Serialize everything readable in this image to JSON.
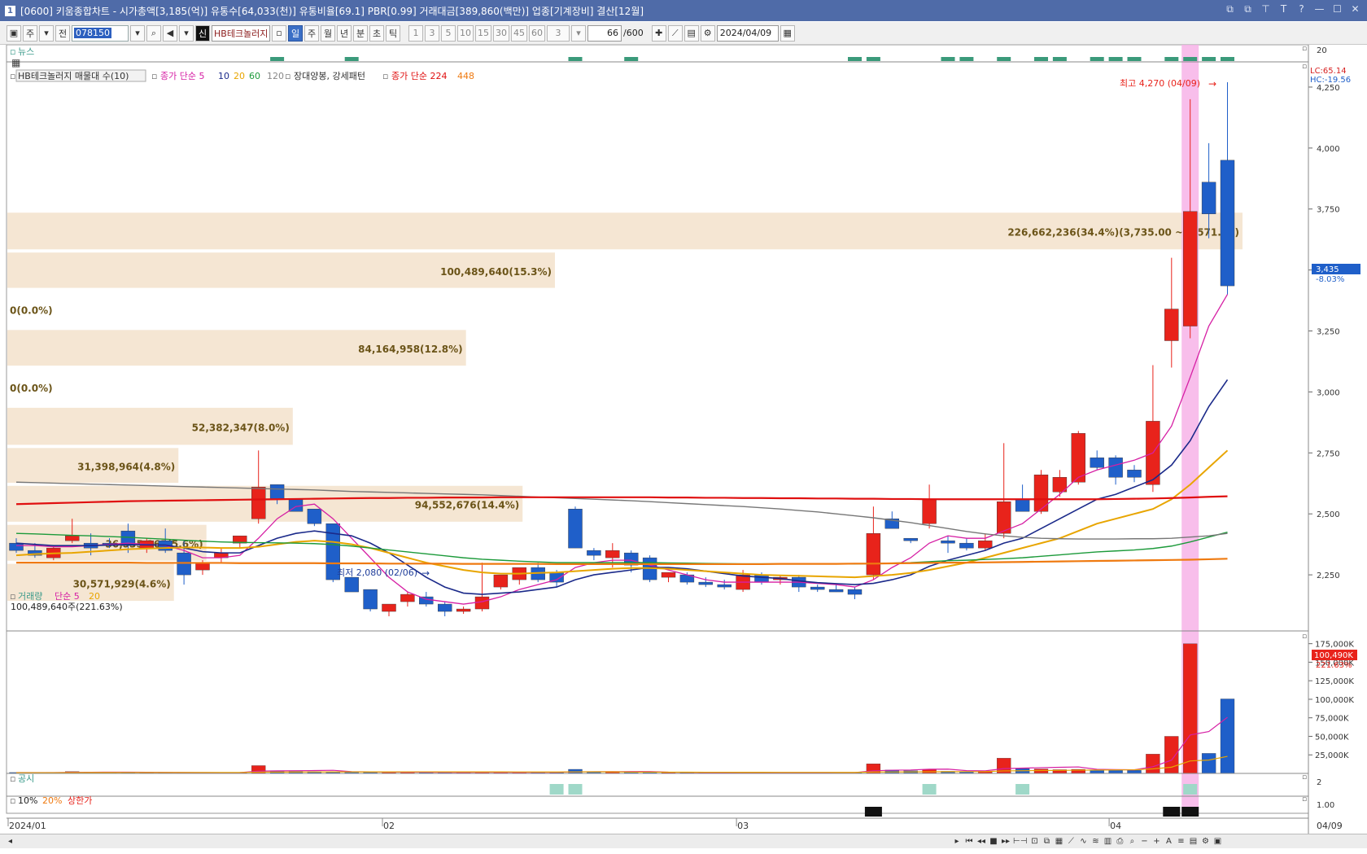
{
  "window": {
    "icon_label": "1",
    "title": "[0600] 키움종합차트 - 시가총액[3,185(억)] 유통수[64,033(천)] 유통비율[69.1] PBR[0.99] 거래대금[389,860(백만)] 업종[기계장비] 결산[12월]",
    "buttons": [
      "⧉",
      "⧉",
      "⊤",
      "T",
      "?",
      "—",
      "☐",
      "✕"
    ]
  },
  "toolbar": {
    "period_main": "주",
    "prev_label": "전",
    "stock_code": "078150",
    "stock_name": "HB테크놀러지",
    "timeframes": [
      "일",
      "주",
      "월",
      "년",
      "분",
      "초",
      "틱"
    ],
    "selected_timeframe": "일",
    "intervals": [
      "1",
      "3",
      "5",
      "10",
      "15",
      "30",
      "45",
      "60"
    ],
    "interval_select": "3",
    "count_value": "66",
    "count_total": "/600",
    "date": "2024/04/09"
  },
  "legends": {
    "news": "뉴스",
    "price_title": "HB테크놀러지 매물대 수(10)",
    "ma_label": "종가 단순 5",
    "ma_10": "10",
    "ma_20": "20",
    "ma_60": "60",
    "ma_120": "120",
    "pattern": "장대양봉, 강세패턴",
    "ma_long_label": "종가 단순 224",
    "ma_448": "448",
    "volume_title": "거래량",
    "volume_ma": "단순 5",
    "volume_ma20": "20",
    "volume_value": "100,489,640주(221.63%)",
    "disclosure": "공시",
    "limit_10": "10%",
    "limit_20": "20%",
    "limit_upper": "상한가"
  },
  "annotations": {
    "high_label": "최고 4,270 (04/09)",
    "low_label": "최저 2,080 (02/06)",
    "lc": "LC:65.14",
    "hc": "HC:-19.56",
    "current_price": "3,435",
    "current_change": "-8.03%",
    "volume_current": "100,490K",
    "volume_ratio": "221.63%"
  },
  "colors": {
    "up": "#e8231b",
    "down": "#1f5fc9",
    "ma5": "#d61fa4",
    "ma10": "#1b2a8a",
    "ma20": "#e8a500",
    "ma60": "#1c9a3a",
    "ma120": "#777777",
    "ma224": "#e01010",
    "ma448": "#ef7a10",
    "volume_profile": "#f5e6d3",
    "highlight": "#f7b3e8"
  },
  "chart_data": {
    "type": "candlestick",
    "y_ticks": [
      "4,250",
      "4,000",
      "3,750",
      "3,500",
      "3,250",
      "3,000",
      "2,750",
      "2,500",
      "2,250"
    ],
    "y_range": [
      2020,
      4350
    ],
    "news_axis_tick": "20",
    "volume_ticks": [
      "175,000K",
      "150,000K",
      "125,000K",
      "100,000K",
      "75,000K",
      "50,000K",
      "25,000K"
    ],
    "volume_range": [
      0,
      190000
    ],
    "disclosure_tick": "2",
    "limit_tick": "1.00",
    "x_labels": [
      {
        "label": "2024/01",
        "index": 0
      },
      {
        "label": "02",
        "index": 20
      },
      {
        "label": "03",
        "index": 39
      },
      {
        "label": "04",
        "index": 59
      }
    ],
    "last_date_label": "04/09",
    "volume_profile": [
      {
        "label": "226,662,236(34.4%)(3,735.00 ~ 3,571.50)",
        "value": 226662236,
        "low": 3571.5,
        "high": 3735
      },
      {
        "label": "100,489,640(15.3%)",
        "value": 100489640,
        "low": 3414,
        "high": 3571.5
      },
      {
        "label": "0(0.0%)",
        "value": 0,
        "low": 3254,
        "high": 3414
      },
      {
        "label": "84,164,958(12.8%)",
        "value": 84164958,
        "low": 3095,
        "high": 3254
      },
      {
        "label": "0(0.0%)",
        "value": 0,
        "low": 2935,
        "high": 3095
      },
      {
        "label": "52,382,347(8.0%)",
        "value": 52382347,
        "low": 2770,
        "high": 2935
      },
      {
        "label": "31,398,964(4.8%)",
        "value": 31398964,
        "low": 2615,
        "high": 2770
      },
      {
        "label": "94,552,676(14.4%)",
        "value": 94552676,
        "low": 2455,
        "high": 2615
      },
      {
        "label": "36,535,365(5.6%)",
        "value": 36535365,
        "low": 2295,
        "high": 2455
      },
      {
        "label": "30,571,929(4.6%)",
        "value": 30571929,
        "low": 2130,
        "high": 2295
      }
    ],
    "candles": [
      [
        2380,
        2400,
        2340,
        2350
      ],
      [
        2350,
        2380,
        2320,
        2330
      ],
      [
        2320,
        2370,
        2310,
        2360
      ],
      [
        2390,
        2480,
        2380,
        2410
      ],
      [
        2380,
        2420,
        2330,
        2360
      ],
      [
        2380,
        2400,
        2360,
        2370
      ],
      [
        2430,
        2460,
        2340,
        2370
      ],
      [
        2360,
        2400,
        2340,
        2390
      ],
      [
        2390,
        2440,
        2340,
        2350
      ],
      [
        2340,
        2390,
        2210,
        2250
      ],
      [
        2270,
        2310,
        2250,
        2300
      ],
      [
        2320,
        2360,
        2300,
        2340
      ],
      [
        2380,
        2410,
        2360,
        2410
      ],
      [
        2480,
        2760,
        2460,
        2610
      ],
      [
        2620,
        2620,
        2540,
        2560
      ],
      [
        2560,
        2560,
        2520,
        2510
      ],
      [
        2520,
        2520,
        2450,
        2460
      ],
      [
        2460,
        2460,
        2220,
        2230
      ],
      [
        2240,
        2240,
        2190,
        2180
      ],
      [
        2190,
        2190,
        2100,
        2110
      ],
      [
        2100,
        2120,
        2080,
        2130
      ],
      [
        2140,
        2180,
        2120,
        2170
      ],
      [
        2160,
        2180,
        2120,
        2130
      ],
      [
        2130,
        2140,
        2080,
        2100
      ],
      [
        2100,
        2120,
        2090,
        2110
      ],
      [
        2110,
        2300,
        2100,
        2160
      ],
      [
        2200,
        2240,
        2190,
        2250
      ],
      [
        2230,
        2270,
        2210,
        2280
      ],
      [
        2280,
        2300,
        2220,
        2230
      ],
      [
        2260,
        2270,
        2200,
        2220
      ],
      [
        2520,
        2530,
        2360,
        2360
      ],
      [
        2350,
        2360,
        2310,
        2330
      ],
      [
        2320,
        2380,
        2280,
        2350
      ],
      [
        2340,
        2350,
        2260,
        2290
      ],
      [
        2320,
        2330,
        2220,
        2230
      ],
      [
        2240,
        2260,
        2220,
        2260
      ],
      [
        2250,
        2260,
        2210,
        2220
      ],
      [
        2220,
        2240,
        2200,
        2210
      ],
      [
        2210,
        2230,
        2190,
        2200
      ],
      [
        2190,
        2270,
        2180,
        2250
      ],
      [
        2250,
        2260,
        2210,
        2220
      ],
      [
        2230,
        2250,
        2210,
        2240
      ],
      [
        2240,
        2250,
        2180,
        2200
      ],
      [
        2200,
        2210,
        2180,
        2190
      ],
      [
        2190,
        2210,
        2180,
        2180
      ],
      [
        2190,
        2200,
        2150,
        2170
      ],
      [
        2250,
        2530,
        2230,
        2420
      ],
      [
        2480,
        2510,
        2460,
        2440
      ],
      [
        2400,
        2400,
        2380,
        2390
      ],
      [
        2460,
        2620,
        2440,
        2560
      ],
      [
        2390,
        2410,
        2340,
        2380
      ],
      [
        2380,
        2400,
        2350,
        2360
      ],
      [
        2360,
        2420,
        2350,
        2390
      ],
      [
        2420,
        2790,
        2400,
        2550
      ],
      [
        2560,
        2620,
        2540,
        2510
      ],
      [
        2510,
        2680,
        2500,
        2660
      ],
      [
        2590,
        2680,
        2570,
        2650
      ],
      [
        2630,
        2840,
        2620,
        2830
      ],
      [
        2730,
        2760,
        2680,
        2690
      ],
      [
        2730,
        2740,
        2620,
        2650
      ],
      [
        2680,
        2700,
        2630,
        2650
      ],
      [
        2620,
        3110,
        2590,
        2880
      ],
      [
        3210,
        3550,
        3100,
        3340
      ],
      [
        3270,
        4200,
        3220,
        3740
      ],
      [
        3860,
        4020,
        3630,
        3730
      ],
      [
        3950,
        4270,
        3400,
        3435
      ]
    ],
    "ma_series": {
      "ma5": [
        2370,
        2370,
        2365,
        2365,
        2370,
        2375,
        2380,
        2375,
        2370,
        2350,
        2320,
        2320,
        2330,
        2400,
        2480,
        2530,
        2540,
        2480,
        2400,
        2320,
        2240,
        2180,
        2150,
        2140,
        2130,
        2140,
        2160,
        2190,
        2210,
        2230,
        2280,
        2300,
        2310,
        2310,
        2290,
        2270,
        2250,
        2230,
        2220,
        2220,
        2220,
        2220,
        2220,
        2215,
        2210,
        2200,
        2230,
        2280,
        2320,
        2380,
        2410,
        2400,
        2400,
        2430,
        2460,
        2520,
        2580,
        2650,
        2680,
        2700,
        2720,
        2750,
        2860,
        3060,
        3270,
        3400
      ],
      "ma10": [
        2380,
        2375,
        2370,
        2370,
        2370,
        2372,
        2374,
        2373,
        2372,
        2360,
        2345,
        2340,
        2340,
        2370,
        2400,
        2420,
        2430,
        2420,
        2410,
        2380,
        2340,
        2290,
        2240,
        2200,
        2175,
        2170,
        2175,
        2180,
        2190,
        2200,
        2230,
        2250,
        2260,
        2270,
        2280,
        2280,
        2275,
        2265,
        2255,
        2245,
        2240,
        2235,
        2225,
        2218,
        2214,
        2210,
        2215,
        2230,
        2250,
        2285,
        2310,
        2330,
        2350,
        2380,
        2400,
        2440,
        2480,
        2520,
        2560,
        2580,
        2610,
        2640,
        2700,
        2800,
        2940,
        3050
      ],
      "ma20": [
        2330,
        2335,
        2338,
        2340,
        2345,
        2350,
        2355,
        2358,
        2360,
        2362,
        2362,
        2360,
        2360,
        2365,
        2375,
        2385,
        2390,
        2385,
        2375,
        2360,
        2340,
        2320,
        2300,
        2285,
        2270,
        2260,
        2255,
        2255,
        2258,
        2260,
        2265,
        2270,
        2275,
        2278,
        2278,
        2275,
        2270,
        2265,
        2260,
        2255,
        2250,
        2248,
        2246,
        2244,
        2242,
        2240,
        2245,
        2250,
        2258,
        2270,
        2285,
        2300,
        2320,
        2340,
        2360,
        2380,
        2400,
        2430,
        2460,
        2480,
        2500,
        2520,
        2560,
        2620,
        2690,
        2760
      ],
      "ma60": [
        2420,
        2418,
        2415,
        2412,
        2410,
        2407,
        2404,
        2400,
        2396,
        2392,
        2388,
        2385,
        2383,
        2382,
        2381,
        2380,
        2378,
        2374,
        2368,
        2360,
        2352,
        2344,
        2336,
        2328,
        2320,
        2314,
        2310,
        2306,
        2303,
        2300,
        2300,
        2300,
        2300,
        2300,
        2300,
        2299,
        2298,
        2297,
        2296,
        2295,
        2295,
        2295,
        2295,
        2295,
        2295,
        2295,
        2296,
        2298,
        2300,
        2304,
        2308,
        2310,
        2313,
        2316,
        2320,
        2326,
        2332,
        2338,
        2344,
        2348,
        2352,
        2358,
        2368,
        2385,
        2405,
        2425
      ],
      "ma120": [
        2630,
        2628,
        2626,
        2624,
        2622,
        2620,
        2618,
        2616,
        2614,
        2612,
        2610,
        2608,
        2606,
        2604,
        2602,
        2600,
        2598,
        2595,
        2592,
        2590,
        2588,
        2586,
        2584,
        2582,
        2580,
        2578,
        2575,
        2572,
        2569,
        2566,
        2563,
        2560,
        2557,
        2554,
        2550,
        2546,
        2542,
        2538,
        2534,
        2530,
        2525,
        2520,
        2514,
        2508,
        2500,
        2492,
        2484,
        2474,
        2464,
        2452,
        2440,
        2428,
        2418,
        2410,
        2404,
        2400,
        2398,
        2397,
        2397,
        2397,
        2398,
        2398,
        2400,
        2405,
        2410,
        2420
      ],
      "ma224": [
        2540,
        2542,
        2544,
        2546,
        2548,
        2550,
        2552,
        2553,
        2554,
        2555,
        2556,
        2557,
        2558,
        2559,
        2560,
        2561,
        2562,
        2563,
        2564,
        2565,
        2565,
        2566,
        2566,
        2567,
        2567,
        2567,
        2568,
        2568,
        2568,
        2568,
        2568,
        2568,
        2568,
        2568,
        2568,
        2567,
        2567,
        2566,
        2566,
        2565,
        2565,
        2564,
        2564,
        2563,
        2563,
        2562,
        2562,
        2561,
        2561,
        2560,
        2560,
        2560,
        2560,
        2560,
        2560,
        2560,
        2560,
        2560,
        2560,
        2561,
        2562,
        2563,
        2565,
        2567,
        2570,
        2572
      ],
      "ma448": [
        2300,
        2300,
        2300,
        2300,
        2300,
        2300,
        2300,
        2299,
        2299,
        2299,
        2299,
        2299,
        2298,
        2298,
        2298,
        2298,
        2298,
        2297,
        2297,
        2297,
        2296,
        2296,
        2296,
        2296,
        2295,
        2295,
        2295,
        2295,
        2295,
        2294,
        2294,
        2294,
        2294,
        2294,
        2294,
        2294,
        2294,
        2294,
        2294,
        2294,
        2294,
        2295,
        2295,
        2295,
        2295,
        2296,
        2296,
        2297,
        2298,
        2299,
        2300,
        2300,
        2301,
        2302,
        2303,
        2304,
        2305,
        2306,
        2307,
        2308,
        2309,
        2310,
        2311,
        2312,
        2314,
        2316
      ]
    },
    "volume": [
      1200,
      900,
      1500,
      2500,
      1800,
      1500,
      1200,
      1000,
      900,
      1500,
      800,
      900,
      1200,
      10500,
      3000,
      2800,
      2500,
      2000,
      1800,
      1500,
      1200,
      1800,
      1600,
      1300,
      1100,
      2000,
      1500,
      1300,
      1200,
      1100,
      5500,
      2200,
      1800,
      1400,
      1600,
      1200,
      1100,
      1000,
      900,
      1300,
      1100,
      1000,
      1300,
      1000,
      900,
      1200,
      13000,
      4500,
      3500,
      5200,
      2800,
      2600,
      3000,
      20500,
      6500,
      6000,
      5000,
      5500,
      4500,
      4800,
      4200,
      26000,
      50000,
      175000,
      27000,
      100490
    ],
    "volume_ma5": [
      1100,
      1100,
      1150,
      1350,
      1580,
      1640,
      1700,
      1600,
      1380,
      1220,
      1100,
      1020,
      1060,
      2980,
      3400,
      3640,
      3840,
      4160,
      2420,
      2120,
      1800,
      1760,
      1580,
      1480,
      1400,
      1560,
      1500,
      1460,
      1420,
      1440,
      2120,
      2260,
      2360,
      2440,
      2500,
      1640,
      1460,
      1260,
      1160,
      1100,
      1080,
      1060,
      1140,
      1140,
      1060,
      1080,
      3480,
      4340,
      4620,
      5640,
      5800,
      3720,
      3420,
      6420,
      7100,
      7780,
      8200,
      8700,
      5500,
      5160,
      4800,
      9000,
      17900,
      51900,
      56500,
      75700
    ],
    "volume_ma20": [
      1000,
      1000,
      1050,
      1100,
      1200,
      1250,
      1300,
      1300,
      1300,
      1300,
      1300,
      1280,
      1280,
      1700,
      1800,
      1900,
      2000,
      2050,
      2100,
      2100,
      2100,
      2150,
      2150,
      2100,
      2050,
      2050,
      2050,
      2000,
      1950,
      1950,
      2150,
      2200,
      2200,
      1800,
      1750,
      1700,
      1650,
      1600,
      1600,
      1550,
      1500,
      1450,
      1450,
      1450,
      1400,
      1400,
      1900,
      2000,
      2050,
      2250,
      2350,
      2400,
      2450,
      3350,
      3600,
      3850,
      4050,
      4300,
      4500,
      4700,
      4900,
      6100,
      8400,
      16800,
      18000,
      23000
    ],
    "highlight_index": 63,
    "news_bars": [
      14,
      18,
      30,
      33,
      45,
      46,
      50,
      51,
      53,
      55,
      56,
      58,
      59,
      60,
      62,
      63,
      64,
      65
    ],
    "disclosure_bars": [
      29,
      30,
      49,
      54,
      63
    ],
    "limit_bars": [
      46,
      62,
      63
    ]
  }
}
